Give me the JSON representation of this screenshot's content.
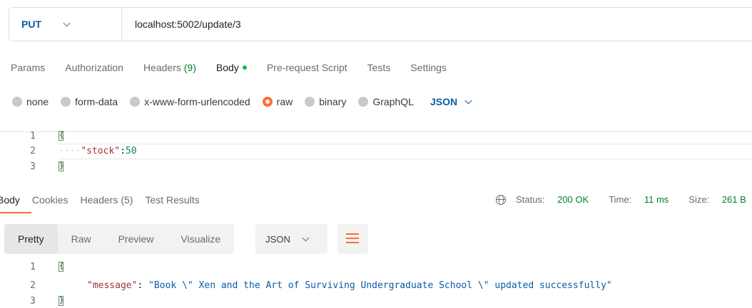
{
  "request": {
    "method": "PUT",
    "url": "localhost:5002/update/3"
  },
  "request_tabs": [
    {
      "label": "Params"
    },
    {
      "label": "Authorization"
    },
    {
      "label": "Headers",
      "count": "(9)"
    },
    {
      "label": "Body"
    },
    {
      "label": "Pre-request Script"
    },
    {
      "label": "Tests"
    },
    {
      "label": "Settings"
    }
  ],
  "body_modes": [
    "none",
    "form-data",
    "x-www-form-urlencoded",
    "raw",
    "binary",
    "GraphQL"
  ],
  "body_language": "JSON",
  "request_body": {
    "line_numbers": [
      "1",
      "2",
      "3"
    ],
    "line1": "{",
    "key": "\"stock\"",
    "colon": ":",
    "value": "50",
    "line3": "}"
  },
  "response_tabs": [
    "Body",
    "Cookies",
    "Headers (5)",
    "Test Results"
  ],
  "status": {
    "status_label": "Status:",
    "status_value": "200 OK",
    "time_label": "Time:",
    "time_value": "11 ms",
    "size_label": "Size:",
    "size_value": "261 B"
  },
  "view_modes": [
    "Pretty",
    "Raw",
    "Preview",
    "Visualize"
  ],
  "response_format": "JSON",
  "response_body": {
    "line_numbers": [
      "1",
      "2",
      "3"
    ],
    "key": "\"message\"",
    "value": "\"Book \\\" Xen and the Art of Surviving Undergraduate School \\\" updated successfully\""
  },
  "colors": {
    "accent": "#ff6c37",
    "method": "#0d5aa7",
    "status_ok": "#007f31",
    "body_dot": "#0cbb52"
  }
}
